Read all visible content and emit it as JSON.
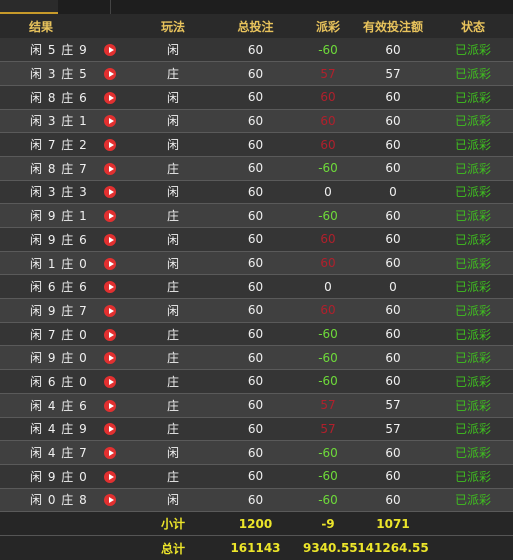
{
  "colors": {
    "accent": "#e8c35c",
    "negative": "#b0202c",
    "positive": "#6edb3a",
    "status": "#3fbf1f",
    "total": "#ece52a"
  },
  "headers": {
    "result": "结果",
    "play": "玩法",
    "total_bet": "总投注",
    "payout": "派彩",
    "valid_bet": "有效投注额",
    "status": "状态"
  },
  "rows": [
    {
      "result": "闲 5 庄 9",
      "play": "闲",
      "bet": "60",
      "payout": "-60",
      "valid": "60",
      "status": "已派彩"
    },
    {
      "result": "闲 3 庄 5",
      "play": "庄",
      "bet": "60",
      "payout": "57",
      "valid": "57",
      "status": "已派彩"
    },
    {
      "result": "闲 8 庄 6",
      "play": "闲",
      "bet": "60",
      "payout": "60",
      "valid": "60",
      "status": "已派彩"
    },
    {
      "result": "闲 3 庄 1",
      "play": "闲",
      "bet": "60",
      "payout": "60",
      "valid": "60",
      "status": "已派彩"
    },
    {
      "result": "闲 7 庄 2",
      "play": "闲",
      "bet": "60",
      "payout": "60",
      "valid": "60",
      "status": "已派彩"
    },
    {
      "result": "闲 8 庄 7",
      "play": "庄",
      "bet": "60",
      "payout": "-60",
      "valid": "60",
      "status": "已派彩"
    },
    {
      "result": "闲 3 庄 3",
      "play": "闲",
      "bet": "60",
      "payout": "0",
      "valid": "0",
      "status": "已派彩"
    },
    {
      "result": "闲 9 庄 1",
      "play": "庄",
      "bet": "60",
      "payout": "-60",
      "valid": "60",
      "status": "已派彩"
    },
    {
      "result": "闲 9 庄 6",
      "play": "闲",
      "bet": "60",
      "payout": "60",
      "valid": "60",
      "status": "已派彩"
    },
    {
      "result": "闲 1 庄 0",
      "play": "闲",
      "bet": "60",
      "payout": "60",
      "valid": "60",
      "status": "已派彩"
    },
    {
      "result": "闲 6 庄 6",
      "play": "庄",
      "bet": "60",
      "payout": "0",
      "valid": "0",
      "status": "已派彩"
    },
    {
      "result": "闲 9 庄 7",
      "play": "闲",
      "bet": "60",
      "payout": "60",
      "valid": "60",
      "status": "已派彩"
    },
    {
      "result": "闲 7 庄 0",
      "play": "庄",
      "bet": "60",
      "payout": "-60",
      "valid": "60",
      "status": "已派彩"
    },
    {
      "result": "闲 9 庄 0",
      "play": "庄",
      "bet": "60",
      "payout": "-60",
      "valid": "60",
      "status": "已派彩"
    },
    {
      "result": "闲 6 庄 0",
      "play": "庄",
      "bet": "60",
      "payout": "-60",
      "valid": "60",
      "status": "已派彩"
    },
    {
      "result": "闲 4 庄 6",
      "play": "庄",
      "bet": "60",
      "payout": "57",
      "valid": "57",
      "status": "已派彩"
    },
    {
      "result": "闲 4 庄 9",
      "play": "庄",
      "bet": "60",
      "payout": "57",
      "valid": "57",
      "status": "已派彩"
    },
    {
      "result": "闲 4 庄 7",
      "play": "闲",
      "bet": "60",
      "payout": "-60",
      "valid": "60",
      "status": "已派彩"
    },
    {
      "result": "闲 9 庄 0",
      "play": "庄",
      "bet": "60",
      "payout": "-60",
      "valid": "60",
      "status": "已派彩"
    },
    {
      "result": "闲 0 庄 8",
      "play": "闲",
      "bet": "60",
      "payout": "-60",
      "valid": "60",
      "status": "已派彩"
    }
  ],
  "subtotal": {
    "label": "小计",
    "bet": "1200",
    "payout": "-9",
    "valid": "1071"
  },
  "total": {
    "label": "总计",
    "bet": "161143",
    "payout": "9340.55",
    "valid": "141264.55"
  }
}
